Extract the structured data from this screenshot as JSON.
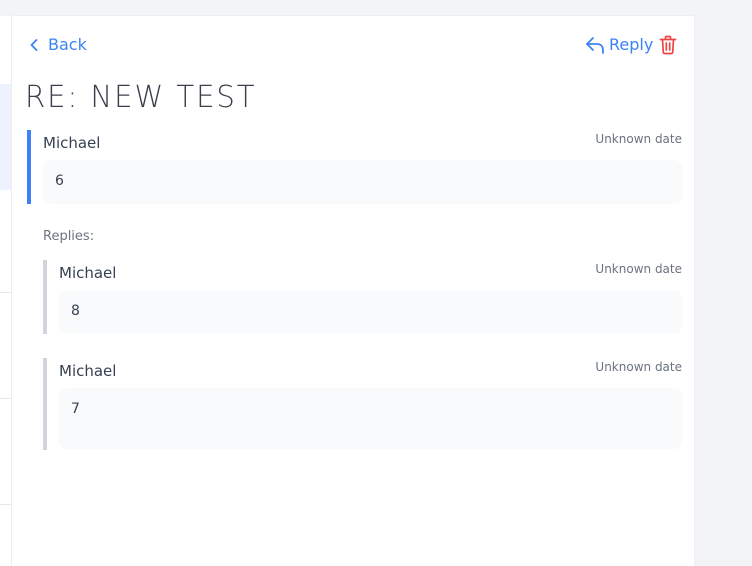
{
  "nav": {
    "back_label": "Back",
    "reply_label": "Reply"
  },
  "colors": {
    "accent": "#3b82f6",
    "danger": "#ef4444",
    "reply_border": "#d1d5db"
  },
  "thread": {
    "title": "RE: NEW TEST",
    "message": {
      "author": "Michael",
      "date": "Unknown date",
      "body": "6"
    },
    "replies_label": "Replies:",
    "replies": [
      {
        "author": "Michael",
        "date": "Unknown date",
        "body": "8"
      },
      {
        "author": "Michael",
        "date": "Unknown date",
        "body": "7"
      }
    ]
  }
}
